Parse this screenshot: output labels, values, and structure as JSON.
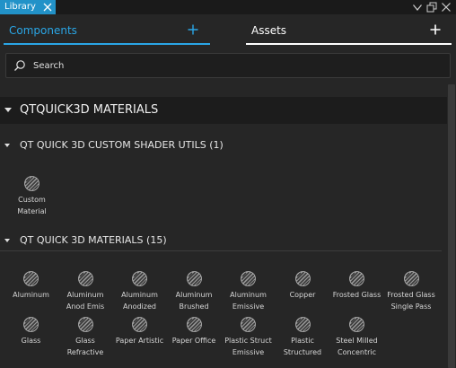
{
  "window": {
    "tab_label": "Library"
  },
  "tabs": {
    "components_label": "Components",
    "assets_label": "Assets",
    "active": "components"
  },
  "search": {
    "placeholder": "Search",
    "value": ""
  },
  "section": {
    "title": "QTQUICK3D MATERIALS"
  },
  "categories": [
    {
      "title": "QT QUICK 3D CUSTOM SHADER UTILS (1)",
      "items": [
        {
          "label": "Custom Material"
        }
      ]
    },
    {
      "title": "QT QUICK 3D MATERIALS (15)",
      "items": [
        {
          "label": "Aluminum"
        },
        {
          "label": "Aluminum Anod Emis"
        },
        {
          "label": "Aluminum Anodized"
        },
        {
          "label": "Aluminum Brushed"
        },
        {
          "label": "Aluminum Emissive"
        },
        {
          "label": "Copper"
        },
        {
          "label": "Frosted Glass"
        },
        {
          "label": "Frosted Glass Single Pass"
        },
        {
          "label": "Glass"
        },
        {
          "label": "Glass Refractive"
        },
        {
          "label": "Paper Artistic"
        },
        {
          "label": "Paper Office"
        },
        {
          "label": "Plastic Struct Emissive"
        },
        {
          "label": "Plastic Structured"
        },
        {
          "label": "Steel Milled Concentric"
        }
      ]
    }
  ],
  "colors": {
    "accent": "#2aa6e6",
    "tab_bg": "#2292c8",
    "panel_bg": "#262626",
    "section_bg": "#1c1c1c"
  },
  "icons": {
    "material": "material-sphere-icon",
    "search": "search-icon",
    "add": "plus-icon",
    "close": "close-icon"
  }
}
